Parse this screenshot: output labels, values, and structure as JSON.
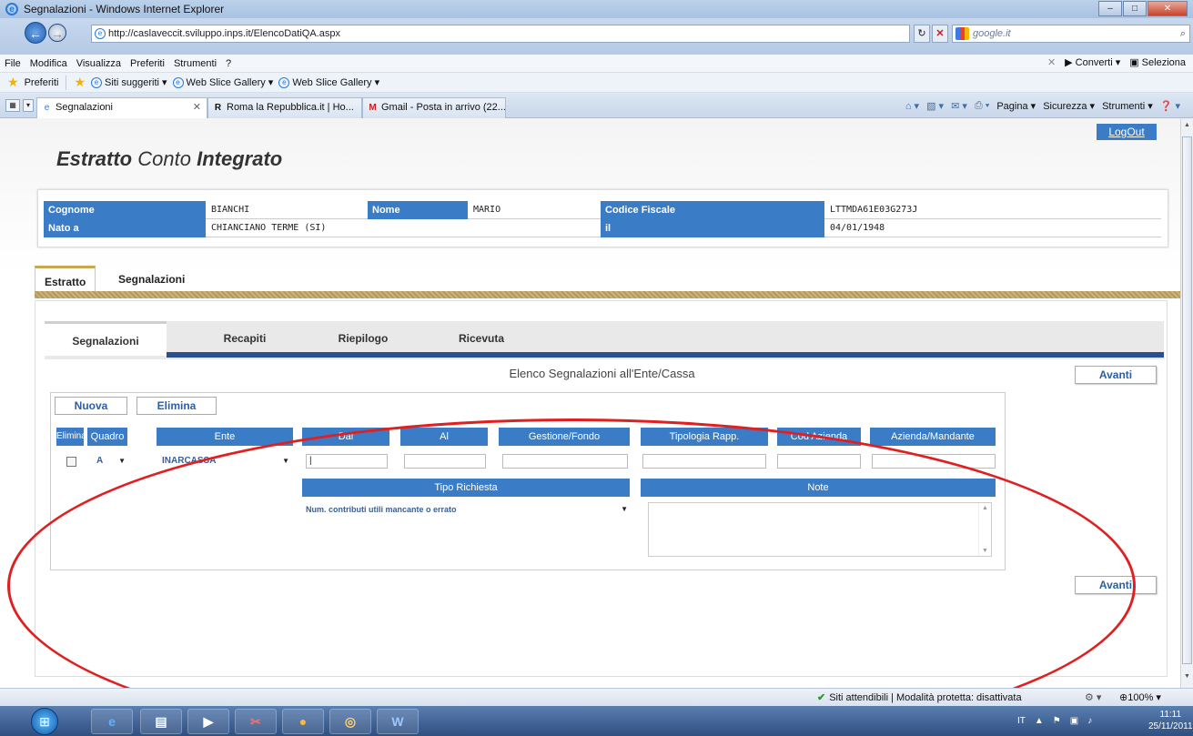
{
  "window": {
    "title": "Segnalazioni - Windows Internet Explorer"
  },
  "address": {
    "url": "http://caslaveccit.sviluppo.inps.it/ElencoDatiQA.aspx",
    "search_placeholder": "google.it"
  },
  "menu": [
    "File",
    "Modifica",
    "Visualizza",
    "Preferiti",
    "Strumenti",
    "?"
  ],
  "menu_right": {
    "converti": "Converti",
    "seleziona": "Seleziona"
  },
  "favorites": {
    "label": "Preferiti",
    "items": [
      "Siti suggeriti ▾",
      "Web Slice Gallery ▾",
      "Web Slice Gallery ▾"
    ]
  },
  "tabs": [
    {
      "label": "Segnalazioni"
    },
    {
      "label": "Roma la Repubblica.it | Ho..."
    },
    {
      "label": "Gmail - Posta in arrivo (22..."
    }
  ],
  "commandbar": [
    "Pagina ▾",
    "Sicurezza ▾",
    "Strumenti ▾"
  ],
  "app": {
    "logout": "LogOut",
    "title_bold1": "Estratto",
    "title_light": "Conto",
    "title_bold2": "Integrato"
  },
  "person": {
    "cognome_label": "Cognome",
    "cognome": "BIANCHI",
    "nome_label": "Nome",
    "nome": "MARIO",
    "cf_label": "Codice Fiscale",
    "cf": "LTTMDA61E03G273J",
    "nato_label": "Nato a",
    "nato": "CHIANCIANO TERME (SI)",
    "il_label": "il",
    "il": "04/01/1948"
  },
  "outer_tabs": [
    "Estratto",
    "Segnalazioni"
  ],
  "inner_tabs": [
    "Segnalazioni",
    "Recapiti",
    "Riepilogo",
    "Ricevuta"
  ],
  "panel": {
    "heading": "Elenco Segnalazioni all'Ente/Cassa",
    "avanti": "Avanti",
    "nuova": "Nuova",
    "elimina": "Elimina"
  },
  "columns": [
    "Elimina",
    "Quadro",
    "Ente",
    "Dal",
    "Al",
    "Gestione/Fondo",
    "Tipologia Rapp.",
    "Cod Azienda",
    "Azienda/Mandante"
  ],
  "row": {
    "quadro": "A",
    "ente": "INARCASSA",
    "elimina_checked": false
  },
  "tipo_richiesta": {
    "label": "Tipo Richiesta",
    "value": "Num. contributi utili mancante o errato"
  },
  "note": {
    "label": "Note"
  },
  "status": {
    "zone": "Siti attendibili | Modalità protetta: disattivata",
    "zoom": "100%"
  },
  "taskbar": {
    "lang": "IT",
    "time": "11:11",
    "date": "25/11/2011"
  }
}
